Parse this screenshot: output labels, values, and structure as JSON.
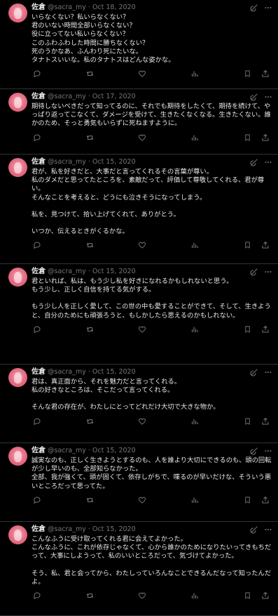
{
  "colors": {
    "background": "#000000",
    "text": "#e7e9ea",
    "secondary": "#71767b",
    "divider": "#2f3336",
    "avatar": "#e46a82"
  },
  "tweets": [
    {
      "author": "佐倉",
      "handle": "@sacra_my",
      "sep": "·",
      "date": "Oct 18, 2020",
      "lines": [
        "いらなくない？私いらなくない？",
        "君のいない時間全部いらなくない？",
        "役に立ってない私いらなくない？",
        "このふわふわした時間に勝ちなくない？",
        "死のうかなあ、ふんわり死にたいな。",
        "タナトスいいな。私のタナトスはどんな姿かな。"
      ]
    },
    {
      "author": "佐倉",
      "handle": "@sacra_my",
      "sep": "·",
      "date": "Oct 17, 2020",
      "lines": [
        "期待しないべきだって知ってるのに、それでも期待をしたくて、期待を続けて、やっぱり返ってこなくて、ダメージを受けて、生きたくなくなる。生きたくない。誰かのため、そっと勇気もいらずに死ねますように。"
      ]
    },
    {
      "author": "佐倉",
      "handle": "@sacra_my",
      "sep": "·",
      "date": "Oct 15, 2020",
      "lines": [
        "君が、私を好きだと、大事だと言ってくれるその言葉が尊い。",
        "私のダメだと思ってたところを、素敵だって、評価して尊敬してくれる、君が尊い。",
        "そんなことを考えると、どうにも泣きそうになってしまう。",
        "",
        "私を、見つけて、拾い上げてくれて、ありがとう。",
        "",
        "いつか、伝えるときがくるかな。"
      ]
    },
    {
      "author": "佐倉",
      "handle": "@sacra_my",
      "sep": "·",
      "date": "Oct 15, 2020",
      "lines": [
        "君といれば、私は、もう少し私を好きになれるかもしれないと思う。",
        "もう少し、正しく自信を持てる気がする。",
        "",
        "もう少し人を正しく愛して、この世の中も愛することができて、そして、生きようと、自分のためにも頑張ろうと、もしかしたら思えるのかもしれない。"
      ]
    },
    {
      "author": "佐倉",
      "handle": "@sacra_my",
      "sep": "·",
      "date": "Oct 15, 2020",
      "lines": [
        "君は、真正面から、それを魅力だと言ってくれる。",
        "私の好きなところは、そこだって言ってくれる。",
        "",
        "そんな君の存在が、わたしにとってどれだけ大切で大きな物か。"
      ]
    },
    {
      "author": "佐倉",
      "handle": "@sacra_my",
      "sep": "·",
      "date": "Oct 15, 2020",
      "lines": [
        "誠実なのも、正しく生きようとするのも、人を誰より大切にできるのも、頭の回転が少し早いのも、全部知らなかった。",
        "全部、我が強くて、頭が固くて、依存しがちで、喋るのが早いだけな、そういう悪いところだって思ってた。"
      ]
    },
    {
      "author": "佐倉",
      "handle": "@sacra_my",
      "sep": "·",
      "date": "Oct 15, 2020",
      "lines": [
        "こんなふうに受け取ってくれる君に会えてよかった。",
        "こんなふうに、これが依存じゃなくて、心から誰かのためになりたいってきもちだって、大事にしようって、私のいいところだって、気づけてよかった。",
        "",
        "そう、私、君と会ってから、わたしっていろんなことできるんだなって知ったんだよ。"
      ]
    }
  ]
}
